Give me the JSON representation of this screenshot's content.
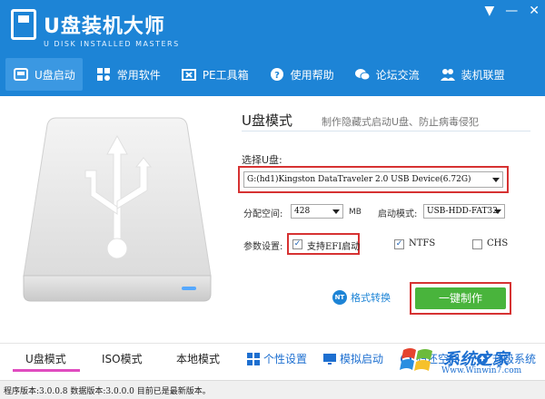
{
  "app": {
    "title": "U盘装机大师",
    "subtitle": "U DISK INSTALLED MASTERS"
  },
  "nav": {
    "items": [
      {
        "label": "U盘启动",
        "icon": "drive-icon",
        "active": true
      },
      {
        "label": "常用软件",
        "icon": "apps-icon"
      },
      {
        "label": "PE工具箱",
        "icon": "toolbox-icon"
      },
      {
        "label": "使用帮助",
        "icon": "help-icon"
      },
      {
        "label": "论坛交流",
        "icon": "chat-icon"
      },
      {
        "label": "装机联盟",
        "icon": "users-icon"
      }
    ]
  },
  "main": {
    "mode_title": "U盘模式",
    "mode_desc": "制作隐藏式启动U盘、防止病毒侵犯",
    "select_label": "选择U盘:",
    "device_value": "G:(hd1)Kingston DataTraveler 2.0 USB Device(6.72G)",
    "partition_label": "分配空间:",
    "partition_value": "428",
    "partition_unit": "MB",
    "boot_mode_label": "启动模式:",
    "boot_mode_value": "USB-HDD-FAT32",
    "params_label": "参数设置:",
    "efi_label": "支持EFI启动",
    "efi_checked": true,
    "ntfs_label": "NTFS",
    "ntfs_checked": true,
    "chs_label": "CHS",
    "chs_checked": false,
    "format_icon": "NT",
    "format_label": "格式转换",
    "make_label": "一键制作"
  },
  "bottom_tabs": {
    "tabs": [
      "U盘模式",
      "ISO模式",
      "本地模式"
    ],
    "links": [
      {
        "label": "个性设置",
        "icon": "grid-icon"
      },
      {
        "label": "模拟启动",
        "icon": "monitor-icon"
      },
      {
        "label": "归还空间",
        "icon": "refresh-icon"
      },
      {
        "label": "升级系统",
        "icon": "upgrade-icon"
      }
    ]
  },
  "status": {
    "text": "程序版本:3.0.0.8  数据版本:3.0.0.0 目前已是最新版本。"
  },
  "watermark": {
    "title": "系统之家",
    "url": "Www.Winwin7.com"
  },
  "colors": {
    "header": "#1d84d6",
    "accent_red": "#d63232",
    "make_green": "#49b43c",
    "tab_underline": "#e04cc0"
  }
}
